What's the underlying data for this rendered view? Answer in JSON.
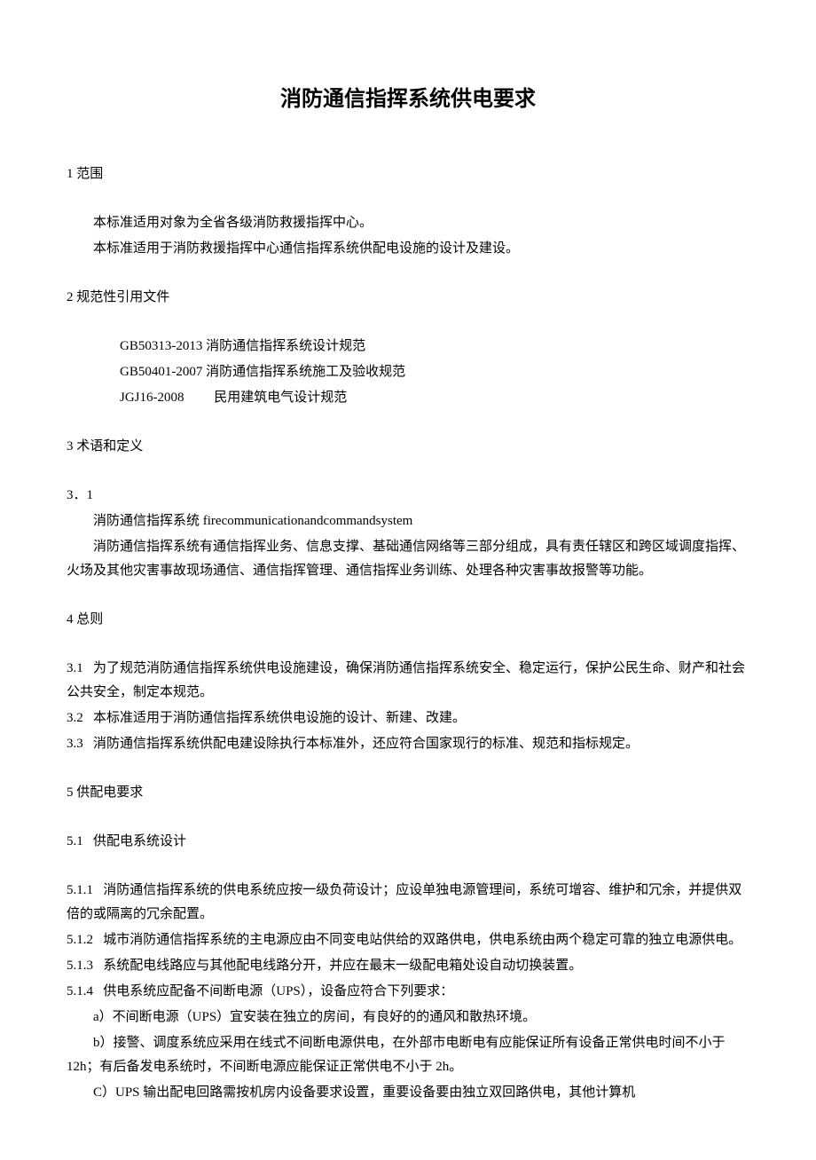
{
  "title": "消防通信指挥系统供电要求",
  "s1": {
    "heading": "1 范围",
    "p1": "本标准适用对象为全省各级消防救援指挥中心。",
    "p2": "本标准适用于消防救援指挥中心通信指挥系统供配电设施的设计及建设。"
  },
  "s2": {
    "heading": "2 规范性引用文件",
    "ref1": "GB50313-2013 消防通信指挥系统设计规范",
    "ref2": "GB50401-2007 消防通信指挥系统施工及验收规范",
    "ref3": "JGJ16-2008         民用建筑电气设计规范"
  },
  "s3": {
    "heading": "3 术语和定义",
    "num": "3．1",
    "term": "消防通信指挥系统 firecommunicationandcommandsystem",
    "def": "消防通信指挥系统有通信指挥业务、信息支撑、基础通信网络等三部分组成，具有责任辖区和跨区域调度指挥、火场及其他灾害事故现场通信、通信指挥管理、通信指挥业务训练、处理各种灾害事故报警等功能。"
  },
  "s4": {
    "heading": "4 总则",
    "p1": "3.1   为了规范消防通信指挥系统供电设施建设，确保消防通信指挥系统安全、稳定运行，保护公民生命、财产和社会公共安全，制定本规范。",
    "p2": "3.2   本标准适用于消防通信指挥系统供电设施的设计、新建、改建。",
    "p3": "3.3   消防通信指挥系统供配电建设除执行本标准外，还应符合国家现行的标准、规范和指标规定。"
  },
  "s5": {
    "heading": "5 供配电要求",
    "sub": "5.1   供配电系统设计",
    "p1": "5.1.1   消防通信指挥系统的供电系统应按一级负荷设计；应设单独电源管理间，系统可增容、维护和冗余，并提供双倍的或隔离的冗余配置。",
    "p2": "5.1.2   城市消防通信指挥系统的主电源应由不同变电站供给的双路供电，供电系统由两个稳定可靠的独立电源供电。",
    "p3": "5.1.3   系统配电线路应与其他配电线路分开，并应在最末一级配电箱处设自动切换装置。",
    "p4": "5.1.4   供电系统应配备不间断电源（UPS），设备应符合下列要求：",
    "p4a": "a）不间断电源（UPS）宜安装在独立的房间，有良好的的通风和散热环境。",
    "p4b": "b）接警、调度系统应采用在线式不间断电源供电，在外部市电断电有应能保证所有设备正常供电时间不小于 12h；有后备发电系统时，不间断电源应能保证正常供电不小于 2h。",
    "p4c": "C）UPS 输出配电回路需按机房内设备要求设置，重要设备要由独立双回路供电，其他计算机"
  }
}
